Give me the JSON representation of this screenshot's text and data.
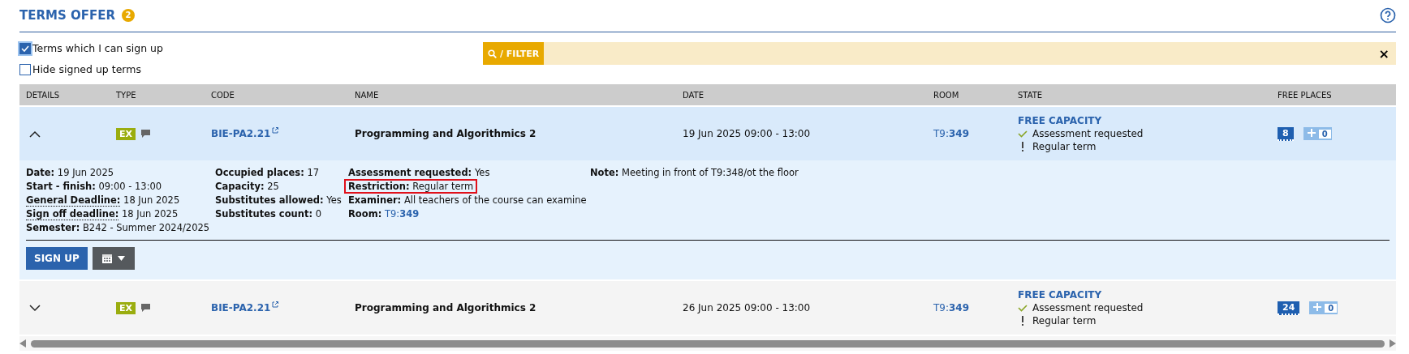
{
  "header": {
    "title": "TERMS OFFER",
    "count": "2"
  },
  "filters": [
    {
      "label": "Terms which I can sign up",
      "checked": true
    },
    {
      "label": "Hide signed up terms",
      "checked": false
    }
  ],
  "filter_bar": {
    "label": "/ FILTER",
    "close": "×"
  },
  "table": {
    "columns": [
      "DETAILS",
      "TYPE",
      "CODE",
      "NAME",
      "DATE",
      "ROOM",
      "STATE",
      "FREE PLACES"
    ],
    "rows": [
      {
        "expanded": true,
        "type": "EX",
        "code": "BIE-PA2.21",
        "name": "Programming and Algorithmics 2",
        "date": "19 Jun 2025 09:00 - 13:00",
        "room": "T9:**349**",
        "state_title": "FREE CAPACITY",
        "state_lines": [
          {
            "kind": "check",
            "text": "Assessment requested"
          },
          {
            "kind": "warning",
            "text": "Regular term"
          }
        ],
        "free": "8",
        "substitutes": "0",
        "details": [
          [
            {
              "label": "Date:",
              "value": "19 Jun 2025",
              "dotted": false,
              "highlighted": false
            },
            {
              "label": "Start - finish:",
              "value": "09:00 - 13:00",
              "dotted": false,
              "highlighted": false
            },
            {
              "label": "General Deadline:",
              "value": "18 Jun 2025",
              "dotted": true,
              "highlighted": false
            },
            {
              "label": "Sign off deadline:",
              "value": "18 Jun 2025",
              "dotted": true,
              "highlighted": false
            },
            {
              "label": "Semester:",
              "value": "B242 - Summer 2024/2025",
              "dotted": false,
              "highlighted": false
            }
          ],
          [
            {
              "label": "Occupied places:",
              "value": "17",
              "dotted": false,
              "highlighted": false
            },
            {
              "label": "Capacity:",
              "value": "25",
              "dotted": false,
              "highlighted": false
            },
            {
              "label": "Substitutes allowed:",
              "value": "Yes",
              "dotted": false,
              "highlighted": false
            },
            {
              "label": "Substitutes count:",
              "value": "0",
              "dotted": false,
              "highlighted": false
            }
          ],
          [
            {
              "label": "Assessment requested:",
              "value": "Yes",
              "dotted": false,
              "highlighted": false
            },
            {
              "label": "Restriction:",
              "value": "Regular term",
              "dotted": false,
              "highlighted": true
            },
            {
              "label": "Examiner:",
              "value": "All teachers of the course can examine",
              "dotted": false,
              "highlighted": false
            },
            {
              "label": "Room:",
              "value": "T9:**349**",
              "kind": "link",
              "dotted": false,
              "highlighted": false
            }
          ],
          [
            {
              "label": "Note:",
              "value": "Meeting in front of T9:348/ot the floor",
              "dotted": false,
              "highlighted": false
            }
          ]
        ],
        "sign_up": "SIGN UP"
      },
      {
        "expanded": false,
        "type": "EX",
        "code": "BIE-PA2.21",
        "name": "Programming and Algorithmics 2",
        "date": "26 Jun 2025 09:00 - 13:00",
        "room": "T9:**349**",
        "state_title": "FREE CAPACITY",
        "state_lines": [
          {
            "kind": "check",
            "text": "Assessment requested"
          },
          {
            "kind": "warning",
            "text": "Regular term"
          }
        ],
        "free": "24",
        "substitutes": "0"
      }
    ]
  }
}
